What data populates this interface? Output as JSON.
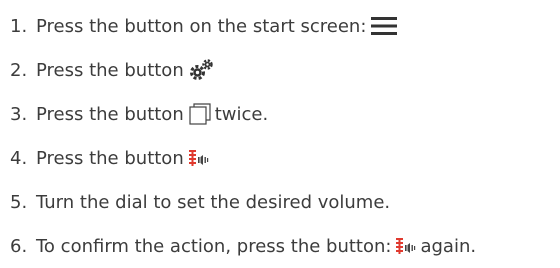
{
  "steps": [
    {
      "number": "1.",
      "text_before": "Press the button on the start screen:",
      "icon": "menu-icon",
      "text_after": ""
    },
    {
      "number": "2.",
      "text_before": "Press the button",
      "icon": "gears-icon",
      "text_after": ""
    },
    {
      "number": "3.",
      "text_before": "Press the button",
      "icon": "copy-window-icon",
      "text_after": "twice."
    },
    {
      "number": "4.",
      "text_before": "Press the button",
      "icon": "sound-bars-icon",
      "text_after": ""
    },
    {
      "number": "5.",
      "text_before": "Turn the dial to set the desired volume.",
      "icon": "",
      "text_after": ""
    },
    {
      "number": "6.",
      "text_before": "To confirm the action, press the button:",
      "icon": "sound-bars-icon",
      "text_after": "again."
    }
  ],
  "colors": {
    "text": "#3c3c3c",
    "icon_dark": "#333333",
    "icon_red": "#e03a2f"
  }
}
